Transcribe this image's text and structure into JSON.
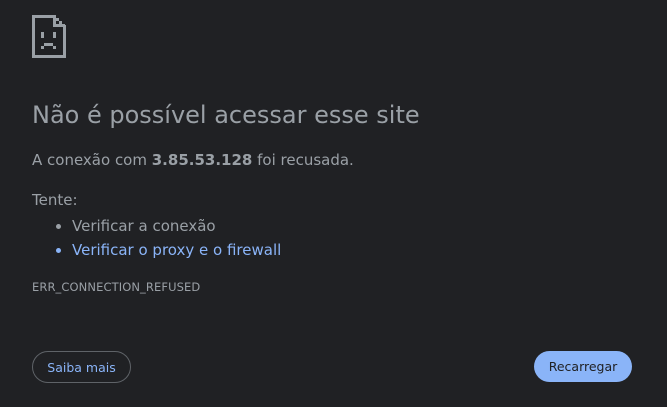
{
  "error_page": {
    "title": "Não é possível acessar esse site",
    "message_prefix": "A conexão com ",
    "host": "3.85.53.128",
    "message_suffix": " foi recusada.",
    "try_label": "Tente:",
    "suggestions": [
      "Verificar a conexão",
      "Verificar o proxy e o firewall"
    ],
    "error_code": "ERR_CONNECTION_REFUSED"
  },
  "buttons": {
    "learn_more": "Saiba mais",
    "reload": "Recarregar"
  },
  "icons": {
    "error": "sad-page-icon"
  },
  "colors": {
    "background": "#202124",
    "text": "#9aa0a6",
    "link": "#8ab4f8",
    "primary_button": "#8ab4f8"
  }
}
